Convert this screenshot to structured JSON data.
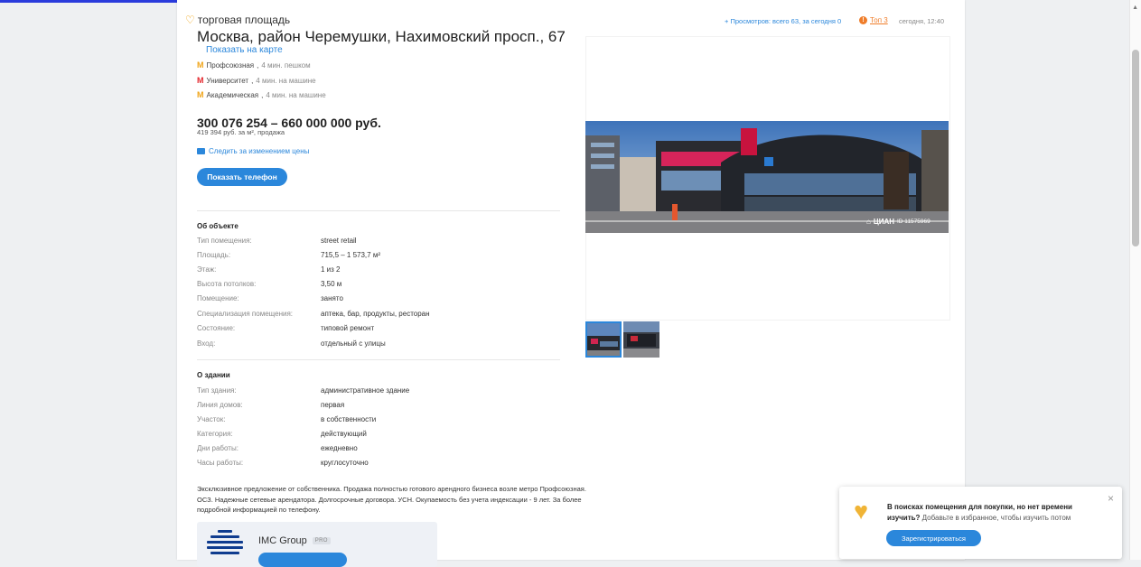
{
  "listing": {
    "type_label": "торговая площадь",
    "title": "Москва, район Черемушки, Нахимовский просп., 67",
    "map_link": "Показать на карте",
    "metro": [
      {
        "station": "Профсоюзная",
        "distance": "4 мин. пешком",
        "color": "#f0a417"
      },
      {
        "station": "Университет",
        "distance": "4 мин. на машине",
        "color": "#e4262c"
      },
      {
        "station": "Академическая",
        "distance": "4 мин. на машине",
        "color": "#f0a417"
      }
    ],
    "price": "300 076 254 – 660 000 000 руб.",
    "price_sub": "419 394 руб. за м², продажа",
    "watch_price": "Следить за изменением цены",
    "phone_button": "Показать телефон"
  },
  "header_meta": {
    "stats": "+ Просмотров: всего 63, за сегодня 0",
    "top_badge": "Топ 3",
    "date": "сегодня, 12:40"
  },
  "object": {
    "title": "Об объекте",
    "rows": [
      {
        "label": "Тип помещения:",
        "value": "street retail"
      },
      {
        "label": "Площадь:",
        "value": "715,5 – 1 573,7 м²"
      },
      {
        "label": "Этаж:",
        "value": "1 из 2"
      },
      {
        "label": "Высота потолков:",
        "value": "3,50 м"
      },
      {
        "label": "Помещение:",
        "value": "занято"
      },
      {
        "label": "Специализация помещения:",
        "value": "аптека, бар, продукты, ресторан"
      },
      {
        "label": "Состояние:",
        "value": "типовой ремонт"
      },
      {
        "label": "Вход:",
        "value": "отдельный с улицы"
      }
    ]
  },
  "building": {
    "title": "О здании",
    "rows": [
      {
        "label": "Тип здания:",
        "value": "административное здание"
      },
      {
        "label": "Линия домов:",
        "value": "первая"
      },
      {
        "label": "Участок:",
        "value": "в собственности"
      },
      {
        "label": "Категория:",
        "value": "действующий"
      },
      {
        "label": "Дни работы:",
        "value": "ежедневно"
      },
      {
        "label": "Часы работы:",
        "value": "круглосуточно"
      }
    ]
  },
  "description": "Эксклюзивное предложение от собственника. Продажа полностью готового арендного бизнеса возле метро Профсоюзная. ОСЗ. Надежные сетевые арендатора. Долгосрочные договора. УСН. Окупаемость без учета индексации - 9 лет. За более подробной информацией по телефону.",
  "agent": {
    "name": "IMC Group",
    "badge": "PRO"
  },
  "gallery": {
    "watermark_brand": "ЦИАН",
    "watermark_id": "ID 11575969"
  },
  "promo": {
    "bold_text": "В поисках помещения для покупки, но нет времени изучить?",
    "text": "Добавьте в избранное, чтобы изучить потом",
    "button": "Зарегистрироваться",
    "close": "×"
  }
}
